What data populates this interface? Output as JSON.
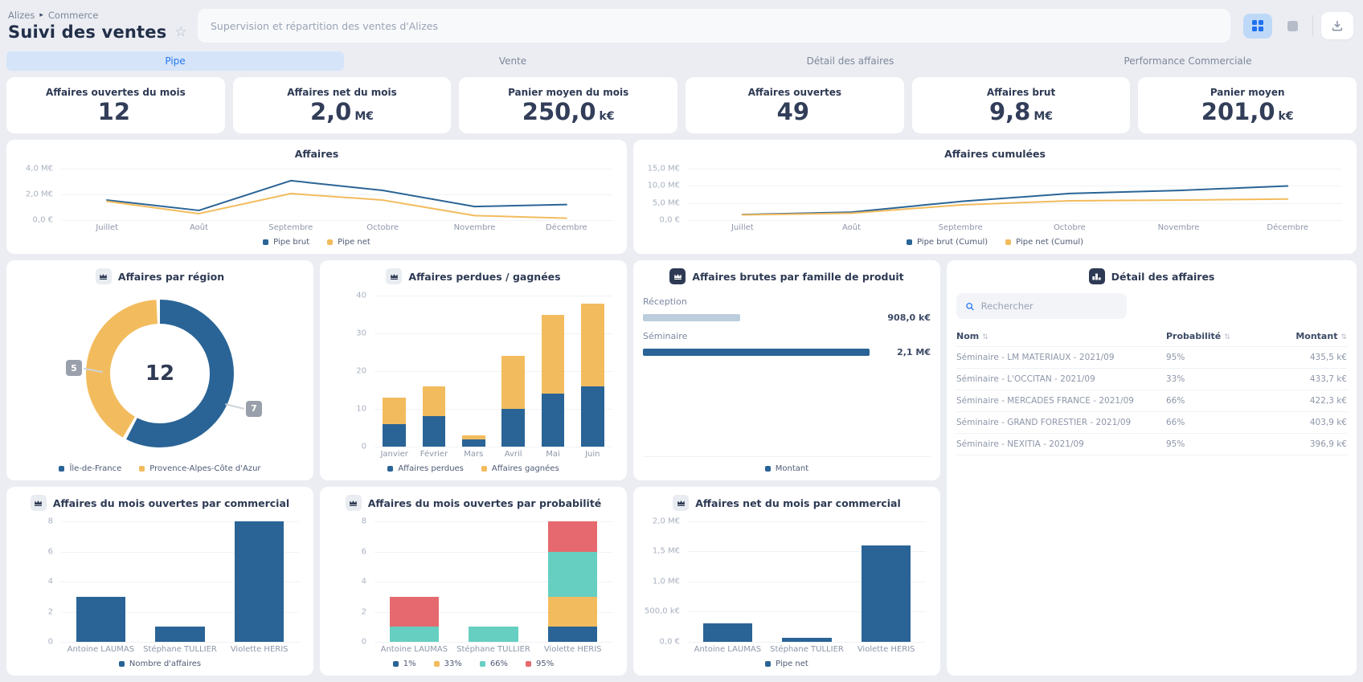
{
  "header": {
    "breadcrumb": [
      "Alizes",
      "Commerce"
    ],
    "title": "Suivi des ventes",
    "description_placeholder": "Supervision et répartition des ventes d'Alizes"
  },
  "tabs": [
    {
      "label": "Pipe",
      "active": true
    },
    {
      "label": "Vente",
      "active": false
    },
    {
      "label": "Détail des affaires",
      "active": false
    },
    {
      "label": "Performance Commerciale",
      "active": false
    }
  ],
  "kpis": [
    {
      "label": "Affaires ouvertes du mois",
      "value": "12",
      "unit": ""
    },
    {
      "label": "Affaires net du mois",
      "value": "2,0",
      "unit": "M€"
    },
    {
      "label": "Panier moyen du mois",
      "value": "250,0",
      "unit": "k€"
    },
    {
      "label": "Affaires ouvertes",
      "value": "49",
      "unit": ""
    },
    {
      "label": "Affaires brut",
      "value": "9,8",
      "unit": "M€"
    },
    {
      "label": "Panier moyen",
      "value": "201,0",
      "unit": "k€"
    }
  ],
  "colors": {
    "blue": "#2a6496",
    "yellow": "#f2bc5e",
    "teal": "#66cfc1",
    "red": "#e5696e",
    "lightbar": "#bccedd",
    "accent": "#2577f2",
    "navy": "#2e3a54"
  },
  "panels": {
    "affaires": {
      "title": "Affaires",
      "chart_data": {
        "type": "line",
        "x": [
          "Juillet",
          "Août",
          "Septembre",
          "Octobre",
          "Novembre",
          "Décembre"
        ],
        "ymax": 4.35,
        "yticks": [
          {
            "label": "4,0 M€",
            "v": 4
          },
          {
            "label": "2,0 M€",
            "v": 2
          },
          {
            "label": "0,0 €",
            "v": 0
          }
        ],
        "series": [
          {
            "name": "Pipe brut",
            "color": "blue",
            "values": [
              1.55,
              0.75,
              3.05,
              2.3,
              1.05,
              1.2
            ]
          },
          {
            "name": "Pipe net",
            "color": "yellow",
            "values": [
              1.45,
              0.5,
              2.05,
              1.55,
              0.35,
              0.15
            ]
          }
        ]
      }
    },
    "cumulees": {
      "title": "Affaires cumulées",
      "chart_data": {
        "type": "line",
        "x": [
          "Juillet",
          "Août",
          "Septembre",
          "Octobre",
          "Novembre",
          "Décembre"
        ],
        "ymax": 16.3,
        "yticks": [
          {
            "label": "15,0 M€",
            "v": 15
          },
          {
            "label": "10,0 M€",
            "v": 10
          },
          {
            "label": "5,0 M€",
            "v": 5
          },
          {
            "label": "0,0 €",
            "v": 0
          }
        ],
        "series": [
          {
            "name": "Pipe brut (Cumul)",
            "color": "blue",
            "values": [
              1.6,
              2.3,
              5.4,
              7.7,
              8.6,
              9.9
            ]
          },
          {
            "name": "Pipe net (Cumul)",
            "color": "yellow",
            "values": [
              1.5,
              2.0,
              4.4,
              5.6,
              5.8,
              6.1
            ]
          }
        ]
      }
    },
    "region": {
      "title": "Affaires par région",
      "icon": "crown-light",
      "chart_data": {
        "type": "donut",
        "center_label": "12",
        "segments": [
          {
            "name": "Île-de-France",
            "color": "blue",
            "value": 7
          },
          {
            "name": "Provence-Alpes-Côte d'Azur",
            "color": "yellow",
            "value": 5
          }
        ]
      }
    },
    "perdues": {
      "title": "Affaires perdues / gagnées",
      "icon": "crown-light",
      "chart_data": {
        "type": "bar",
        "x": [
          "Janvier",
          "Février",
          "Mars",
          "Avril",
          "Mai",
          "Juin"
        ],
        "ymax": 42,
        "bar_width": "58%",
        "yticks": [
          {
            "label": "40",
            "v": 40
          },
          {
            "label": "30",
            "v": 30
          },
          {
            "label": "20",
            "v": 20
          },
          {
            "label": "10",
            "v": 10
          },
          {
            "label": "0",
            "v": 0
          }
        ],
        "series": [
          {
            "name": "Affaires perdues",
            "color": "blue"
          },
          {
            "name": "Affaires gagnées",
            "color": "yellow"
          }
        ],
        "stacks": [
          [
            6,
            7
          ],
          [
            8,
            8
          ],
          [
            2,
            1
          ],
          [
            10,
            14
          ],
          [
            14,
            21
          ],
          [
            16,
            22
          ]
        ]
      }
    },
    "familles": {
      "title": "Affaires brutes par famille de produit",
      "icon": "crown-dark",
      "chart_data": {
        "type": "hbar",
        "rows": [
          {
            "label": "Réception",
            "value": "908,0 k€",
            "pct": 43,
            "color": "lightbar"
          },
          {
            "label": "Séminaire",
            "value": "2,1 M€",
            "pct": 100,
            "color": "blue"
          }
        ],
        "legend": [
          {
            "name": "Montant",
            "color": "blue"
          }
        ]
      }
    },
    "detail": {
      "title": "Détail des affaires",
      "icon": "podium-dark",
      "search_placeholder": "Rechercher",
      "columns": [
        "Nom",
        "Probabilité",
        "Montant"
      ],
      "rows": [
        {
          "nom": "Séminaire - LM MATERIAUX - 2021/09",
          "probabilite": "95%",
          "montant": "435,5 k€"
        },
        {
          "nom": "Séminaire - L'OCCITAN - 2021/09",
          "probabilite": "33%",
          "montant": "433,7 k€"
        },
        {
          "nom": "Séminaire - MERCADES FRANCE - 2021/09",
          "probabilite": "66%",
          "montant": "422,3 k€"
        },
        {
          "nom": "Séminaire - GRAND FORESTIER - 2021/09",
          "probabilite": "66%",
          "montant": "403,9 k€"
        },
        {
          "nom": "Séminaire - NEXITIA - 2021/09",
          "probabilite": "95%",
          "montant": "396,9 k€"
        }
      ]
    },
    "commercial": {
      "title": "Affaires du mois ouvertes par commercial",
      "icon": "crown-light",
      "chart_data": {
        "type": "bar",
        "x": [
          "Antoine LAUMAS",
          "Stéphane TULLIER",
          "Violette HERIS"
        ],
        "ymax": 8.45,
        "bar_width": "62%",
        "yticks": [
          {
            "label": "8",
            "v": 8
          },
          {
            "label": "6",
            "v": 6
          },
          {
            "label": "4",
            "v": 4
          },
          {
            "label": "2",
            "v": 2
          },
          {
            "label": "0",
            "v": 0
          }
        ],
        "series": [
          {
            "name": "Nombre d'affaires",
            "color": "blue"
          }
        ],
        "stacks": [
          [
            3
          ],
          [
            1
          ],
          [
            8
          ]
        ]
      }
    },
    "probabilite": {
      "title": "Affaires du mois ouvertes par probabilité",
      "icon": "crown-light",
      "chart_data": {
        "type": "bar",
        "x": [
          "Antoine LAUMAS",
          "Stéphane TULLIER",
          "Violette HERIS"
        ],
        "ymax": 8.45,
        "bar_width": "62%",
        "yticks": [
          {
            "label": "8",
            "v": 8
          },
          {
            "label": "6",
            "v": 6
          },
          {
            "label": "4",
            "v": 4
          },
          {
            "label": "2",
            "v": 2
          },
          {
            "label": "0",
            "v": 0
          }
        ],
        "series": [
          {
            "name": "1%",
            "color": "blue"
          },
          {
            "name": "33%",
            "color": "yellow"
          },
          {
            "name": "66%",
            "color": "teal"
          },
          {
            "name": "95%",
            "color": "red"
          }
        ],
        "stacks": [
          [
            0,
            0,
            1,
            2
          ],
          [
            0,
            0,
            1,
            0
          ],
          [
            1,
            2,
            3,
            2
          ]
        ]
      }
    },
    "net_commercial": {
      "title": "Affaires net du mois par commercial",
      "icon": "crown-light",
      "chart_data": {
        "type": "bar",
        "x": [
          "Antoine LAUMAS",
          "Stéphane TULLIER",
          "Violette HERIS"
        ],
        "ymax": 2.1,
        "bar_width": "62%",
        "yticks": [
          {
            "label": "2,0 M€",
            "v": 2
          },
          {
            "label": "1,5 M€",
            "v": 1.5
          },
          {
            "label": "1,0 M€",
            "v": 1
          },
          {
            "label": "500,0 k€",
            "v": 0.5
          },
          {
            "label": "0,0 €",
            "v": 0
          }
        ],
        "series": [
          {
            "name": "Pipe net",
            "color": "blue"
          }
        ],
        "stacks": [
          [
            0.31
          ],
          [
            0.07
          ],
          [
            1.6
          ]
        ]
      }
    }
  }
}
